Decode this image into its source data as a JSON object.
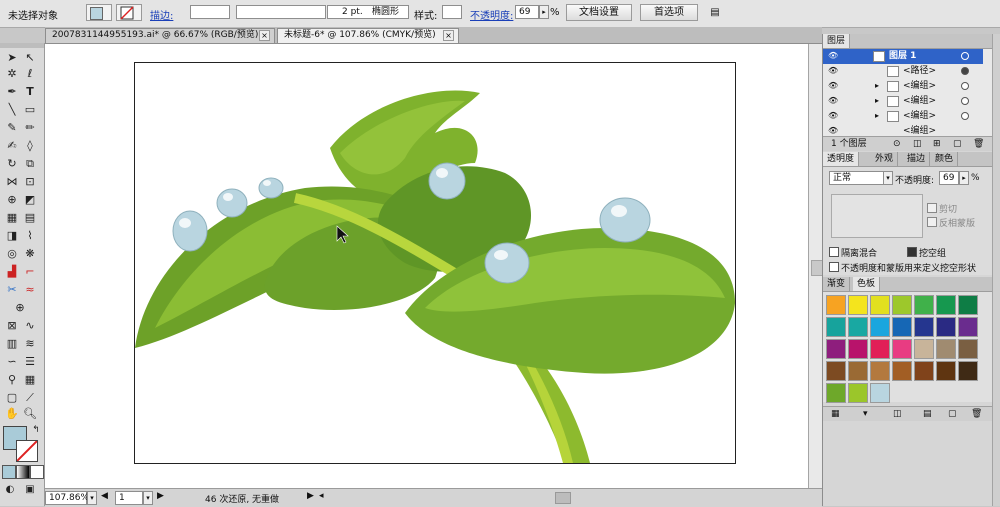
{
  "control_bar": {
    "selection_label": "未选择对象",
    "stroke_link": "描边:",
    "stroke_size_value": "2 pt.",
    "stroke_profile": "椭圆形",
    "style_label": "样式:",
    "opacity_link": "不透明度:",
    "opacity_value": "69",
    "opacity_unit": "%",
    "doc_setup_button": "文档设置",
    "preferences_button": "首选项"
  },
  "tabs": [
    {
      "label": "20078311449551​93.ai* @ 66.67% (RGB/预览)"
    },
    {
      "label": "未标题-6* @ 107.86% (CMYK/预览)"
    }
  ],
  "tab_close_glyph": "×",
  "status_bar": {
    "zoom": "107.86%",
    "page": "1",
    "info": "46 次还原, 无重做"
  },
  "layers_panel": {
    "title": "图层",
    "rows": [
      {
        "label": "图层 1",
        "selected": true
      },
      {
        "label": "<路径>",
        "selected": false
      },
      {
        "label": "<编组>",
        "selected": false
      },
      {
        "label": "<编组>",
        "selected": false
      },
      {
        "label": "<编组>",
        "selected": false
      },
      {
        "label": "<编组>",
        "selected": false
      }
    ],
    "footer_count": "1 个图层"
  },
  "transparency_panel": {
    "tabs": [
      "透明度",
      "外观",
      "描边",
      "颜色"
    ],
    "blend_mode": "正常",
    "opacity_label": "不透明度:",
    "opacity_value": "69",
    "opacity_unit": "%",
    "clip_label": "剪切",
    "invert_mask_label": "反相蒙版",
    "isolate_blending_label": "隔离混合",
    "knockout_group_label": "挖空组",
    "opacity_mask_label": "不透明度和蒙版用来定义挖空形状"
  },
  "swatches_panel": {
    "tabs": [
      "渐变",
      "色板"
    ],
    "colors": [
      "#f7a322",
      "#f4e41d",
      "#e2e01f",
      "#9dc82b",
      "#40b14a",
      "#16984f",
      "#0e7d45",
      "#17a39c",
      "#19a8a2",
      "#1aa6de",
      "#1667b5",
      "#25368f",
      "#2a2a83",
      "#6a2c8e",
      "#8e1e7d",
      "#b8136b",
      "#e11f57",
      "#e83c82",
      "#c8b49a",
      "#a08b70",
      "#7a5f42",
      "#7d4b22",
      "#9a6a34",
      "#b3793f",
      "#a25e24",
      "#80431b",
      "#5f3511",
      "#3f2a15",
      "#6ea82a",
      "#9bc62a",
      "#b9d5e0"
    ]
  },
  "colors": {
    "fill_swatch": "#a9cbd8",
    "accent": "#1a3fb8",
    "selected_row": "#2f63c8"
  }
}
